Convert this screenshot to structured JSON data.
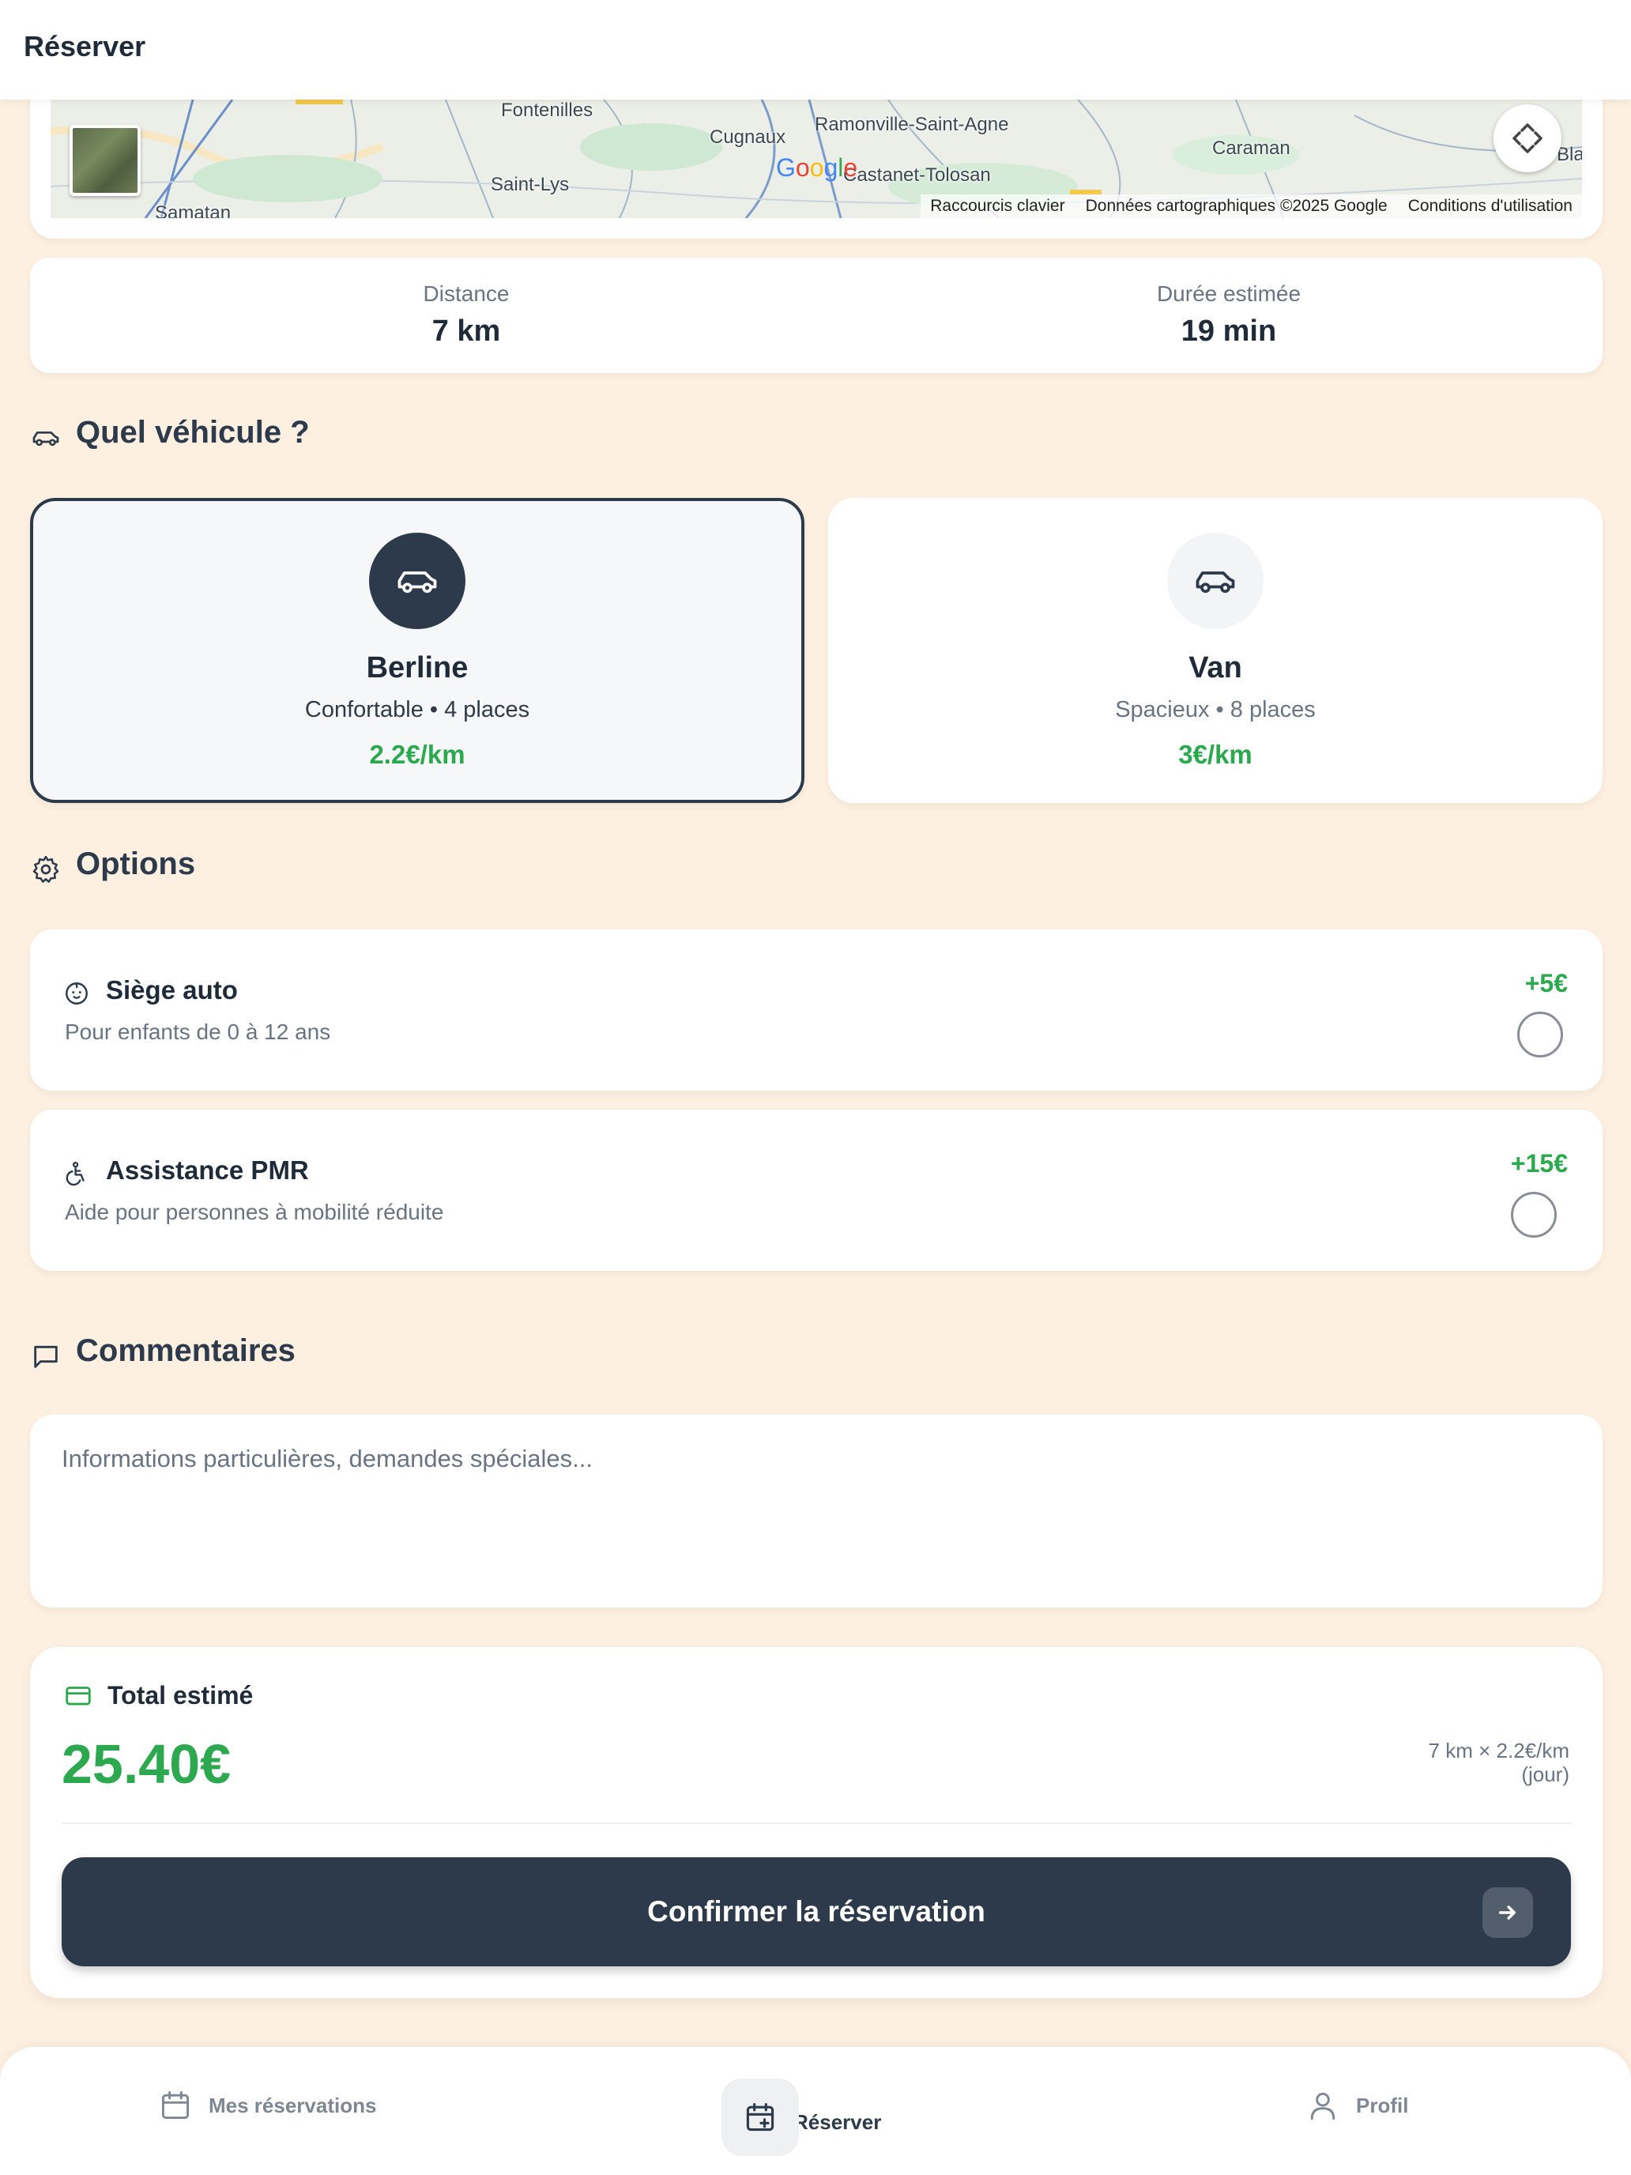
{
  "header": {
    "title": "Réserver"
  },
  "map": {
    "places": [
      "Fontenilles",
      "Cugnaux",
      "Ramonville-Saint-Agne",
      "Caraman",
      "Saint-Lys",
      "Castanet-Tolosan",
      "Bla",
      "Samatan"
    ],
    "google_logo": "Google",
    "footer": {
      "shortcuts": "Raccourcis clavier",
      "data": "Données cartographiques ©2025 Google",
      "terms": "Conditions d'utilisation"
    }
  },
  "stats": {
    "distance_label": "Distance",
    "distance_value": "7 km",
    "duration_label": "Durée estimée",
    "duration_value": "19 min"
  },
  "vehicle_section": {
    "title": "Quel véhicule ?"
  },
  "vehicles": [
    {
      "name": "Berline",
      "desc": "Confortable • 4 places",
      "price": "2.2€/km",
      "selected": true
    },
    {
      "name": "Van",
      "desc": "Spacieux • 8 places",
      "price": "3€/km",
      "selected": false
    }
  ],
  "options_section": {
    "title": "Options"
  },
  "options": [
    {
      "name": "Siège auto",
      "desc": "Pour enfants de 0 à 12 ans",
      "price": "+5€",
      "checked": false
    },
    {
      "name": "Assistance PMR",
      "desc": "Aide pour personnes à mobilité réduite",
      "price": "+15€",
      "checked": false
    }
  ],
  "comments_section": {
    "title": "Commentaires",
    "placeholder": "Informations particulières, demandes spéciales..."
  },
  "total": {
    "label": "Total estimé",
    "amount": "25.40€",
    "calc_line1": "7 km × 2.2€/km",
    "calc_line2": "(jour)",
    "confirm_label": "Confirmer la réservation"
  },
  "bottom_nav": {
    "items": [
      {
        "label": "Mes réservations",
        "icon": "calendar-icon",
        "active": false
      },
      {
        "label": "Réserver",
        "icon": "calendar-plus-icon",
        "active": true
      },
      {
        "label": "Profil",
        "icon": "user-icon",
        "active": false
      }
    ]
  },
  "colors": {
    "accent_green": "#2CA84F",
    "primary_dark": "#2C3A4B",
    "page_bg": "#FDF0E0"
  }
}
